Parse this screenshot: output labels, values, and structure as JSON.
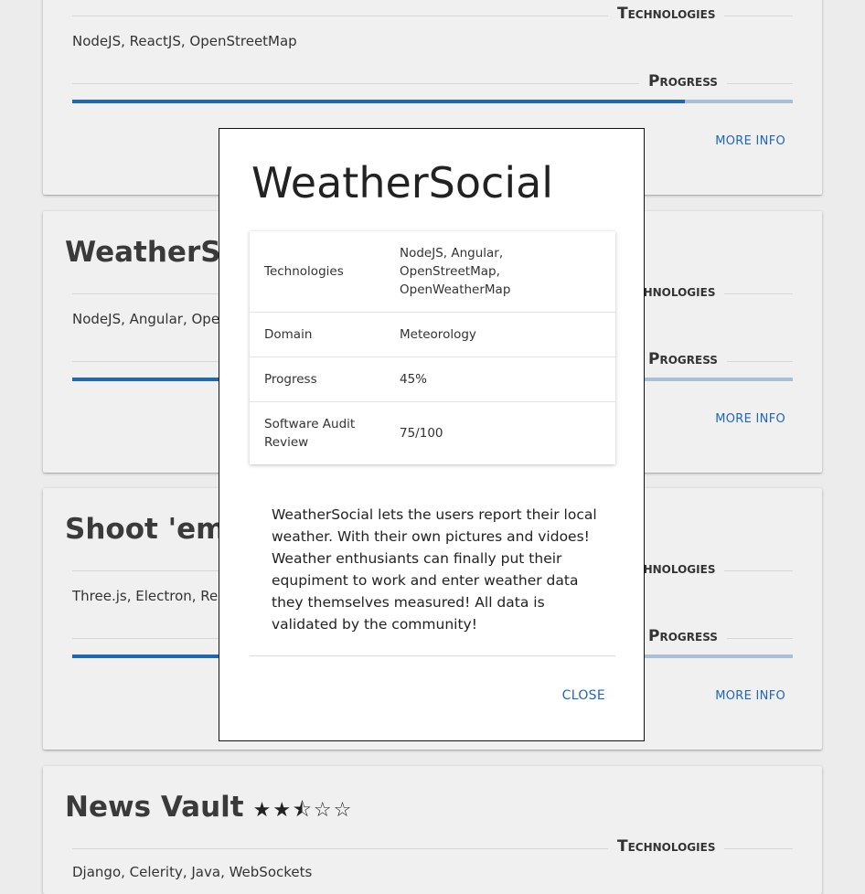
{
  "cards": [
    {
      "title": "",
      "technologies_label": "Technologies",
      "technologies": "NodeJS, ReactJS, OpenStreetMap",
      "progress_label": "Progress",
      "progress": 0.85,
      "more_info": "More Info"
    },
    {
      "title": "WeatherSocial",
      "technologies_label": "Technologies",
      "technologies": "NodeJS, Angular, OpenStreetMap, OpenWeatherMap",
      "progress_label": "Progress",
      "progress": 0.45,
      "more_info": "More Info"
    },
    {
      "title": "Shoot 'em Up",
      "technologies_label": "Technologies",
      "technologies": "Three.js, Electron, React",
      "progress_label": "Progress",
      "progress": 0.6,
      "more_info": "More Info"
    },
    {
      "title": "News Vault",
      "rating": 2.5,
      "rating_stars": "★★⯪☆☆",
      "technologies_label": "Technologies",
      "technologies": "Django, Celerity, Java, WebSockets"
    }
  ],
  "modal": {
    "title": "WeatherSocial",
    "rows": [
      {
        "key": "Technologies",
        "value": "NodeJS, Angular, OpenStreetMap, OpenWeatherMap"
      },
      {
        "key": "Domain",
        "value": "Meteorology"
      },
      {
        "key": "Progress",
        "value": "45%"
      },
      {
        "key": "Software Audit Review",
        "value": "75/100"
      }
    ],
    "description": "WeatherSocial lets the users report their local weather. With their own pictures and vidoes! Weather enthusiants can finally put their equpiment to work and enter weather data they themselves measured! All data is validated by the community!",
    "close_label": "Close"
  },
  "colors": {
    "accent": "#1f66b3",
    "progress_track": "#aabfd6",
    "page_bg": "#ececec",
    "card_bg": "#f0f0f0"
  }
}
